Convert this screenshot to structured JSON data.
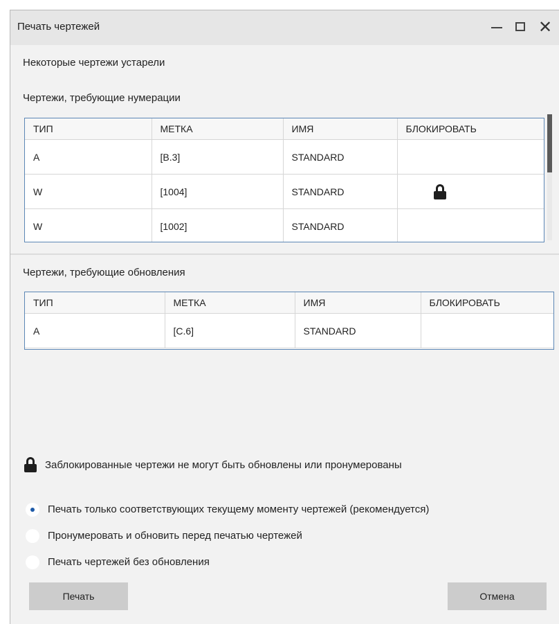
{
  "window": {
    "title": "Печать чертежей",
    "minimize_glyph": "—",
    "maximize_glyph": "☐",
    "close_glyph": "✕"
  },
  "message": "Некоторые чертежи устарели",
  "renumber_section": {
    "title": "Чертежи, требующие нумерации",
    "columns": [
      "ТИП",
      "МЕТКА",
      "ИМЯ",
      "БЛОКИРОВАТЬ"
    ],
    "rows": [
      {
        "type": "A",
        "mark": "[B.3]",
        "name": "STANDARD",
        "locked": false
      },
      {
        "type": "W",
        "mark": "[1004]",
        "name": "STANDARD",
        "locked": true
      },
      {
        "type": "W",
        "mark": "[1002]",
        "name": "STANDARD",
        "locked": false
      }
    ]
  },
  "update_section": {
    "title": "Чертежи, требующие обновления",
    "columns": [
      "ТИП",
      "МЕТКА",
      "ИМЯ",
      "БЛОКИРОВАТЬ"
    ],
    "rows": [
      {
        "type": "A",
        "mark": "[C.6]",
        "name": "STANDARD",
        "locked": false
      }
    ]
  },
  "lock_note": "Заблокированные чертежи не могут быть обновлены или пронумерованы",
  "options": [
    {
      "label": "Печать только соответствующих текущему моменту чертежей (рекомендуется)",
      "checked": true
    },
    {
      "label": "Пронумеровать и обновить перед печатью чертежей",
      "checked": false
    },
    {
      "label": "Печать чертежей без обновления",
      "checked": false
    }
  ],
  "buttons": {
    "print": "Печать",
    "cancel": "Отмена"
  },
  "icons": {
    "lock": "lock-icon"
  },
  "colors": {
    "grid_border": "#5b86b5",
    "radio_dot": "#1e5aa8",
    "button_bg": "#cccccc",
    "window_bg": "#f2f2f2"
  }
}
